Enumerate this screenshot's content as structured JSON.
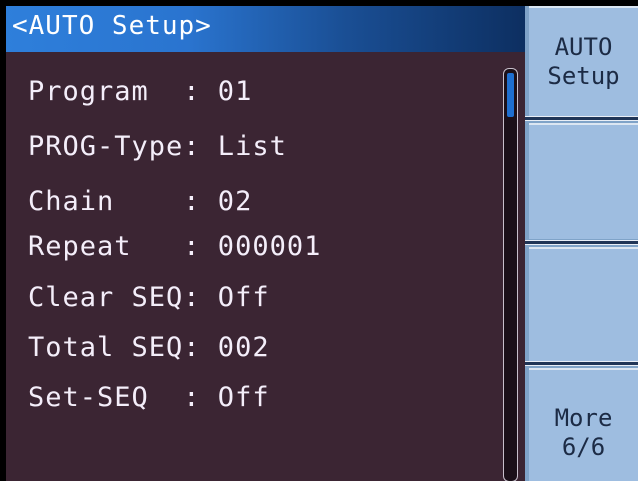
{
  "screen": {
    "title": "<AUTO Setup>",
    "params": [
      {
        "text": "Program  : 01"
      },
      {
        "text": "PROG-Type: List"
      },
      {
        "text": "Chain    : 02"
      },
      {
        "text": "Repeat   : 000001"
      },
      {
        "text": "Clear SEQ: Off"
      },
      {
        "text": "Total SEQ: 002"
      },
      {
        "text": "Set-SEQ  : Off"
      }
    ]
  },
  "softkeys": {
    "key1": {
      "line1": "AUTO",
      "line2": "Setup"
    },
    "key2": {
      "line1": "",
      "line2": ""
    },
    "key3": {
      "line1": "",
      "line2": ""
    },
    "key4": {
      "line1": "More",
      "line2": "6/6"
    }
  },
  "colors": {
    "screen_background": "#3b2533",
    "title_bar_start": "#2e7fdb",
    "softkey_background": "#9ebde0",
    "scrollbar_thumb": "#1e6fd0"
  }
}
